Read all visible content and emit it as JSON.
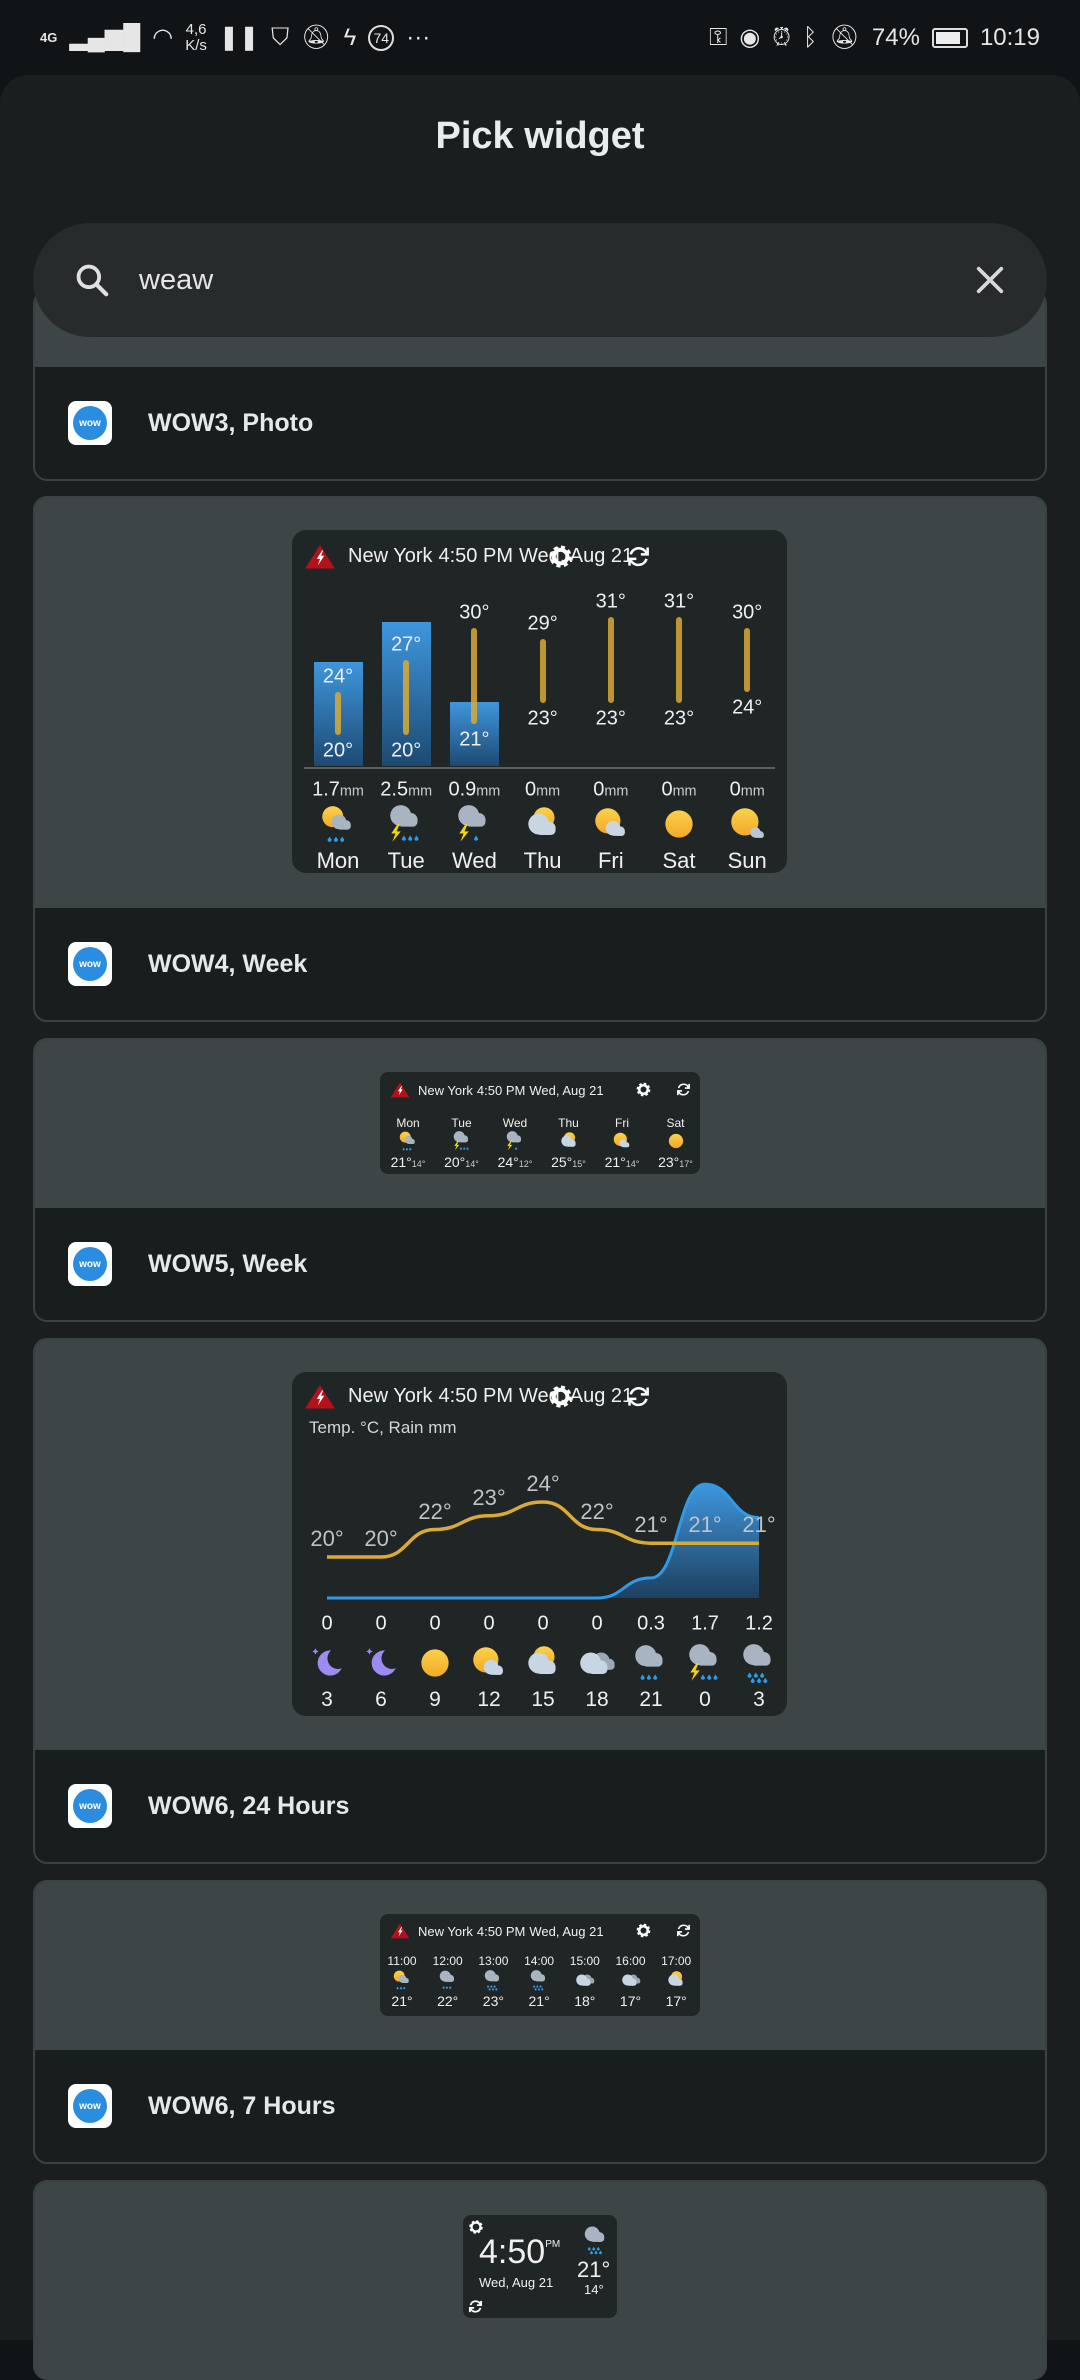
{
  "status_bar": {
    "network": "4G",
    "speed_value": "4,6",
    "speed_unit": "K/s",
    "battery": "74%",
    "time": "10:19",
    "notif_count": "74"
  },
  "title": "Pick widget",
  "search": {
    "value": "weaw",
    "placeholder": "Search"
  },
  "colors": {
    "accent": "#2f9be8",
    "sun": "#f5b82e",
    "temp_line": "#d9aa36",
    "alert": "#b3121a"
  },
  "widget_header": {
    "city": "New York",
    "time": "4:50 PM",
    "date": "Wed, Aug 21"
  },
  "cards": [
    {
      "label": "WOW3, Photo"
    },
    {
      "label": "WOW4, Week"
    },
    {
      "label": "WOW5, Week"
    },
    {
      "label": "WOW6, 24 Hours"
    },
    {
      "label": "WOW6, 7 Hours"
    }
  ],
  "app_icon_text": "wow",
  "week_widget": {
    "days": [
      {
        "day": "Mon",
        "hi": 24,
        "lo": 20,
        "hi_label": "24°",
        "lo_label": "20°",
        "rain": 1.7,
        "rain_label": "1.7",
        "icon": "sun-cloud-rain"
      },
      {
        "day": "Tue",
        "hi": 27,
        "lo": 20,
        "hi_label": "27°",
        "lo_label": "20°",
        "rain": 2.5,
        "rain_label": "2.5",
        "icon": "thunder-rain"
      },
      {
        "day": "Wed",
        "hi": 30,
        "lo": 21,
        "hi_label": "30°",
        "lo_label": "21°",
        "rain": 0.9,
        "rain_label": "0.9",
        "icon": "thunder-light-rain"
      },
      {
        "day": "Thu",
        "hi": 29,
        "lo": 23,
        "hi_label": "29°",
        "lo_label": "23°",
        "rain": 0,
        "rain_label": "0",
        "icon": "cloud-sun"
      },
      {
        "day": "Fri",
        "hi": 31,
        "lo": 23,
        "hi_label": "31°",
        "lo_label": "23°",
        "rain": 0,
        "rain_label": "0",
        "icon": "sun-cloud"
      },
      {
        "day": "Sat",
        "hi": 31,
        "lo": 23,
        "hi_label": "31°",
        "lo_label": "23°",
        "rain": 0,
        "rain_label": "0",
        "icon": "sun"
      },
      {
        "day": "Sun",
        "hi": 30,
        "lo": 24,
        "hi_label": "30°",
        "lo_label": "24°",
        "rain": 0,
        "rain_label": "0",
        "icon": "sun-small-cloud"
      }
    ],
    "rain_unit": "mm"
  },
  "week_small": {
    "days": [
      {
        "day": "Mon",
        "hi": "21°",
        "lo": "14°",
        "icon": "sun-cloud-rain"
      },
      {
        "day": "Tue",
        "hi": "20°",
        "lo": "14°",
        "icon": "thunder-rain"
      },
      {
        "day": "Wed",
        "hi": "24°",
        "lo": "12°",
        "icon": "thunder-light-rain"
      },
      {
        "day": "Thu",
        "hi": "25°",
        "lo": "15°",
        "icon": "cloud-sun"
      },
      {
        "day": "Fri",
        "hi": "21°",
        "lo": "14°",
        "icon": "sun-cloud"
      },
      {
        "day": "Sat",
        "hi": "23°",
        "lo": "17°",
        "icon": "sun"
      }
    ]
  },
  "hours_widget": {
    "subtitle": "Temp. °C, Rain mm",
    "hours": [
      {
        "hour": "3",
        "temp": 20,
        "temp_label": "20°",
        "rain": 0,
        "rain_label": "0",
        "icon": "moon"
      },
      {
        "hour": "6",
        "temp": 20,
        "temp_label": "20°",
        "rain": 0,
        "rain_label": "0",
        "icon": "moon"
      },
      {
        "hour": "9",
        "temp": 22,
        "temp_label": "22°",
        "rain": 0,
        "rain_label": "0",
        "icon": "sun"
      },
      {
        "hour": "12",
        "temp": 23,
        "temp_label": "23°",
        "rain": 0,
        "rain_label": "0",
        "icon": "sun-cloud"
      },
      {
        "hour": "15",
        "temp": 24,
        "temp_label": "24°",
        "rain": 0,
        "rain_label": "0",
        "icon": "cloud-sun"
      },
      {
        "hour": "18",
        "temp": 22,
        "temp_label": "22°",
        "rain": 0,
        "rain_label": "0",
        "icon": "cloudy"
      },
      {
        "hour": "21",
        "temp": 21,
        "temp_label": "21°",
        "rain": 0.3,
        "rain_label": "0.3",
        "icon": "rain"
      },
      {
        "hour": "0",
        "temp": 21,
        "temp_label": "21°",
        "rain": 1.7,
        "rain_label": "1.7",
        "icon": "thunder-rain"
      },
      {
        "hour": "3",
        "temp": 21,
        "temp_label": "21°",
        "rain": 1.2,
        "rain_label": "1.2",
        "icon": "heavy-rain"
      }
    ]
  },
  "hours_small": {
    "hours": [
      {
        "hour": "11:00",
        "temp": "21°",
        "icon": "sun-cloud-rain"
      },
      {
        "hour": "12:00",
        "temp": "22°",
        "icon": "rain"
      },
      {
        "hour": "13:00",
        "temp": "23°",
        "icon": "heavy-rain"
      },
      {
        "hour": "14:00",
        "temp": "21°",
        "icon": "heavy-rain"
      },
      {
        "hour": "15:00",
        "temp": "18°",
        "icon": "cloudy"
      },
      {
        "hour": "16:00",
        "temp": "17°",
        "icon": "cloudy"
      },
      {
        "hour": "17:00",
        "temp": "17°",
        "icon": "cloud-sun"
      }
    ]
  },
  "clock_widget": {
    "time": "4:50",
    "ampm": "PM",
    "date": "Wed, Aug 21",
    "hi": "21°",
    "lo": "14°",
    "icon": "heavy-rain"
  }
}
